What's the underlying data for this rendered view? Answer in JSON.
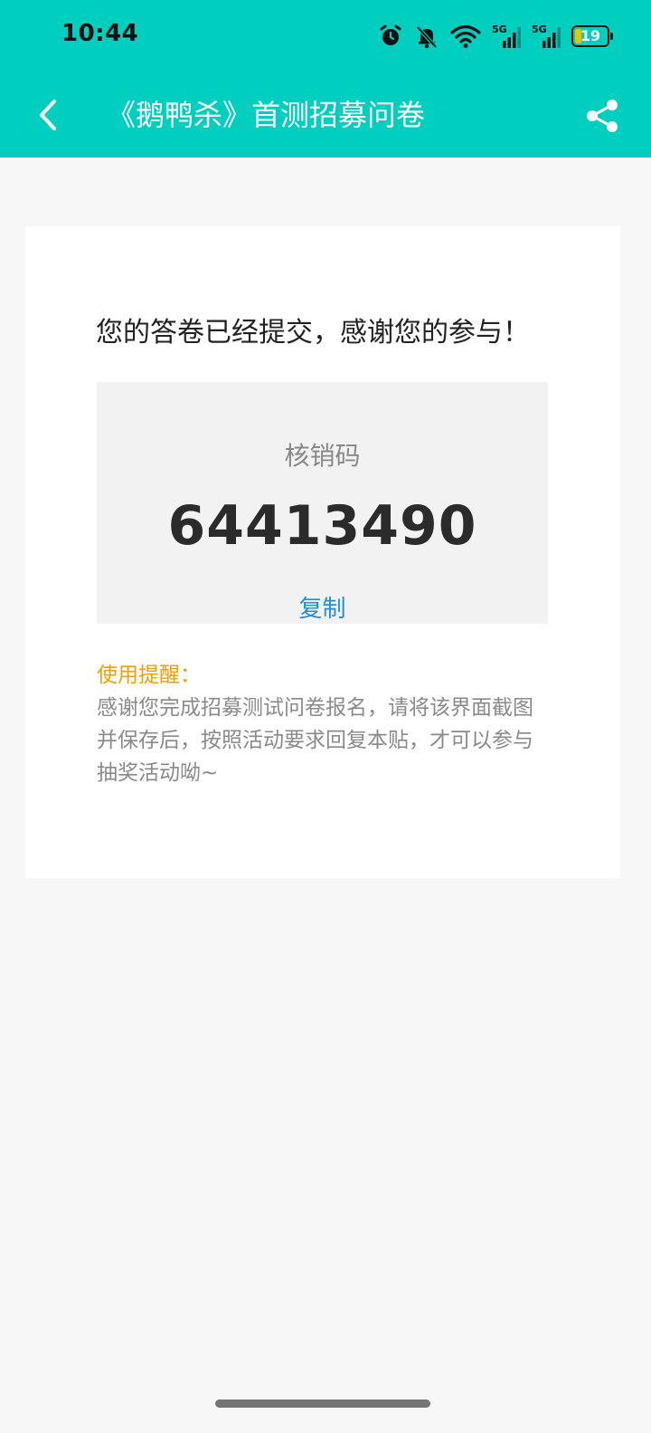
{
  "status_bar": {
    "time": "10:44",
    "battery_level": "19",
    "battery_fill_color": "#f0c000",
    "icons": [
      "alarm-icon",
      "bell-off-icon",
      "wifi-icon",
      "signal-5g-icon",
      "signal-5g-icon",
      "battery-icon"
    ],
    "signal_labels": [
      "5G",
      "5G"
    ]
  },
  "app_bar": {
    "title": "《鹅鸭杀》首测招募问卷",
    "back_icon": "chevron-left-icon",
    "share_icon": "share-icon",
    "background_color": "#00cfc0"
  },
  "result": {
    "message": "您的答卷已经提交，感谢您的参与！",
    "code_label": "核销码",
    "code_value": "64413490",
    "copy_label": "复制"
  },
  "reminder": {
    "title": "使用提醒：",
    "body": "感谢您完成招募测试问卷报名，请将该界面截图并保存后，按照活动要求回复本贴，才可以参与抽奖活动呦~"
  },
  "colors": {
    "accent": "#00cfc0",
    "link": "#1f8ee0",
    "reminder_title": "#f0a000"
  }
}
